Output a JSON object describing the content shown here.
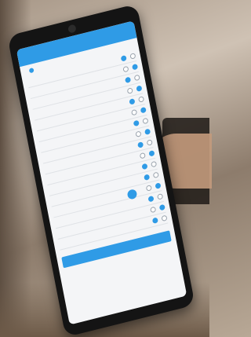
{
  "scene": {
    "description_colors": {
      "accent": "#2f9be6",
      "warning": "#e23b3b",
      "phone_body": "#141414"
    }
  },
  "app": {
    "title": "",
    "section_heading": "",
    "submit_label": "",
    "warning_text": ""
  },
  "questions": [
    {
      "text": "",
      "selected": "yes"
    },
    {
      "text": "",
      "selected": "no"
    },
    {
      "text": "",
      "selected": "yes"
    },
    {
      "text": "",
      "selected": "no"
    },
    {
      "text": "",
      "selected": "yes"
    },
    {
      "text": "",
      "selected": "no"
    },
    {
      "text": "",
      "selected": "yes"
    },
    {
      "text": "",
      "selected": "no"
    },
    {
      "text": "",
      "selected": "yes"
    },
    {
      "text": "",
      "selected": "no"
    },
    {
      "text": "",
      "selected": "yes"
    },
    {
      "text": "",
      "selected": "yes"
    },
    {
      "text": "",
      "selected": "no"
    },
    {
      "text": "",
      "selected": "yes"
    },
    {
      "text": "",
      "selected": "no"
    },
    {
      "text": "",
      "selected": "yes"
    }
  ]
}
